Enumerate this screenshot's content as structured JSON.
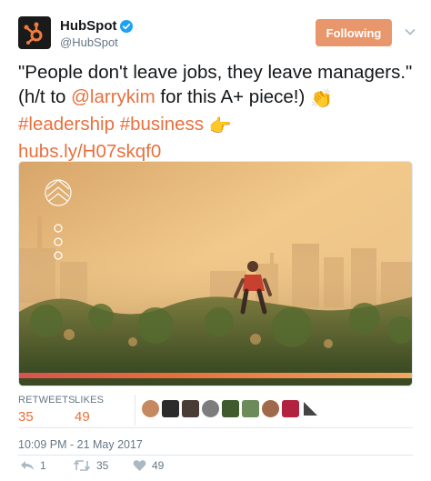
{
  "account": {
    "display_name": "HubSpot",
    "handle": "@HubSpot",
    "follow_label": "Following"
  },
  "tweet": {
    "text_before_mention": "\"People don't leave jobs, they leave managers.\" (h/t to ",
    "mention": "@larrykim",
    "text_after_mention": " for this A+ piece!) ",
    "clap_emoji": "👏",
    "hashtag_1": "#leadership",
    "hashtag_2": "#business",
    "point_emoji": "👉",
    "url": "hubs.ly/H07skqf0"
  },
  "stats": {
    "retweets_label": "RETWEETS",
    "retweets_value": "35",
    "likes_label": "LIKES",
    "likes_value": "49"
  },
  "timestamp": "10:09 PM - 21 May 2017",
  "actions": {
    "reply_count": "1",
    "retweet_count": "35",
    "like_count": "49"
  },
  "colors": {
    "accent": "#e8703d",
    "follow_button": "#e8966b",
    "muted": "#657786"
  },
  "icons": [
    "hubspot-logo-icon",
    "verified-badge-icon",
    "chevron-down-icon",
    "reply-icon",
    "retweet-icon",
    "heart-icon"
  ]
}
